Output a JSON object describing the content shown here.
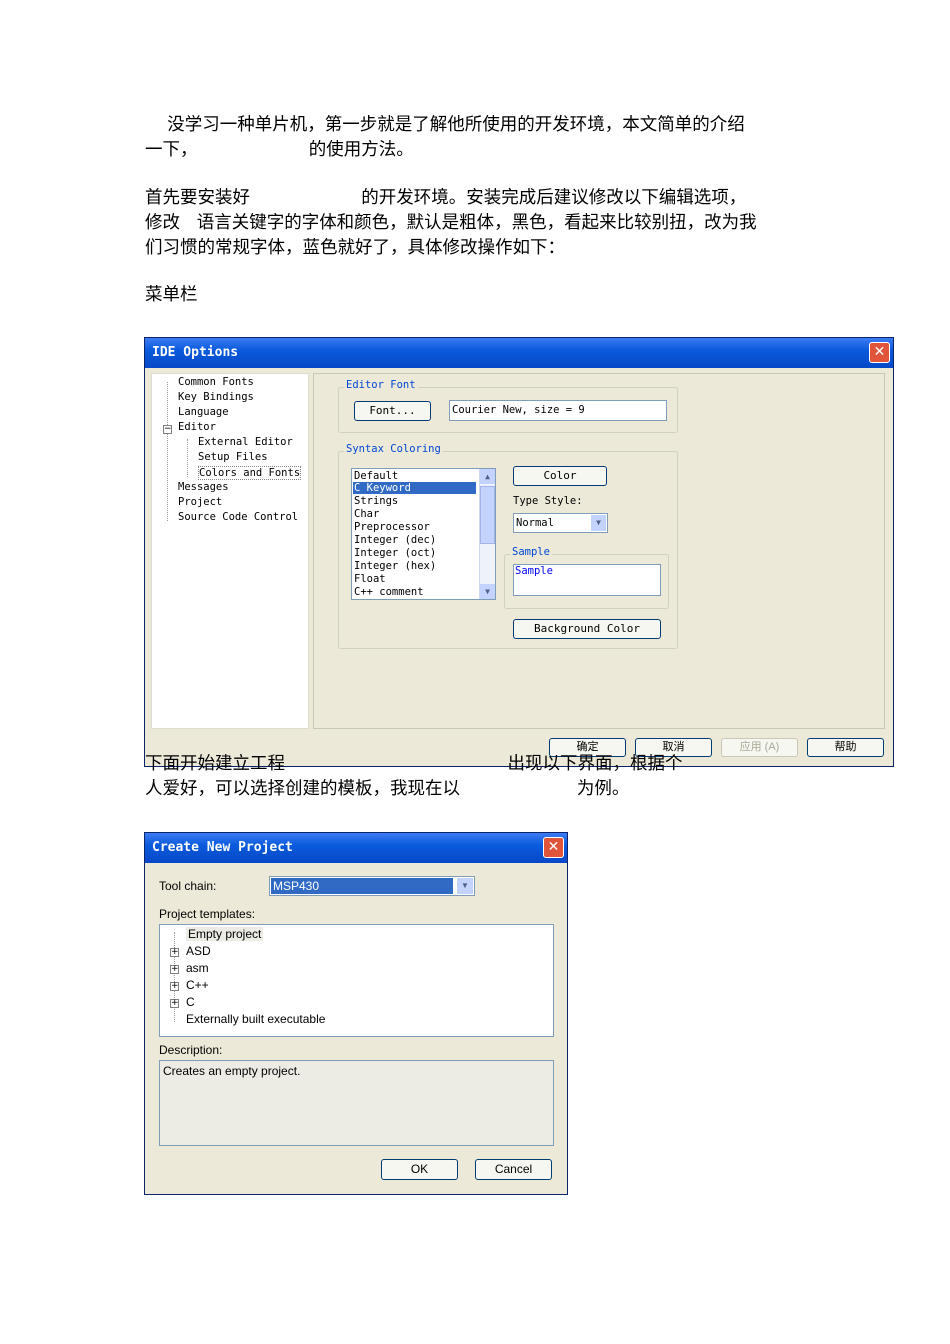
{
  "paragraphs": {
    "p1_line1": "    没学习一种单片机，第一步就是了解他所使用的开发环境，本文简单的介绍",
    "p1_line2": "一下，                    的使用方法。",
    "p2_line1": "首先要安装好                    的开发环境。安装完成后建议修改以下编辑选项，",
    "p2_line2": "修改   语言关键字的字体和颜色，默认是粗体，黑色，看起来比较别扭，改为我",
    "p2_line3": "们习惯的常规字体，蓝色就好了，具体修改操作如下：",
    "p3": "菜单栏",
    "p4_line1": "下面开始建立工程                                        出现以下界面，根据个",
    "p4_line2": "人爱好，可以选择创建的模板，我现在以                     为例。"
  },
  "ide_options": {
    "title": "IDE Options",
    "close": "✕",
    "tree": [
      "Common Fonts",
      "Key Bindings",
      "Language",
      "Editor",
      "External Editor",
      "Setup Files",
      "Colors and Fonts",
      "Messages",
      "Project",
      "Source Code Control"
    ],
    "editor_font_label": "Editor Font",
    "font_button": "Font...",
    "font_value": "Courier New, size = 9",
    "syntax_label": "Syntax Coloring",
    "syntax_items": [
      "Default",
      "C Keyword",
      "Strings",
      "Char",
      "Preprocessor",
      "Integer (dec)",
      "Integer (oct)",
      "Integer (hex)",
      "Float",
      "C++ comment"
    ],
    "color_button": "Color",
    "type_style_label": "Type Style:",
    "type_style_value": "Normal",
    "sample_label": "Sample",
    "sample_text": "Sample",
    "background_button": "Background Color",
    "ok": "确定",
    "cancel": "取消",
    "apply": "应用 (A)",
    "help": "帮助"
  },
  "create_project": {
    "title": "Create New Project",
    "close": "✕",
    "toolchain_label": "Tool chain:",
    "toolchain_value": "MSP430",
    "templates_label": "Project templates:",
    "templates": [
      "Empty project",
      "ASD",
      "asm",
      "C++",
      "C",
      "Externally built executable"
    ],
    "description_label": "Description:",
    "description_text": "Creates an empty project.",
    "ok": "OK",
    "cancel": "Cancel"
  }
}
